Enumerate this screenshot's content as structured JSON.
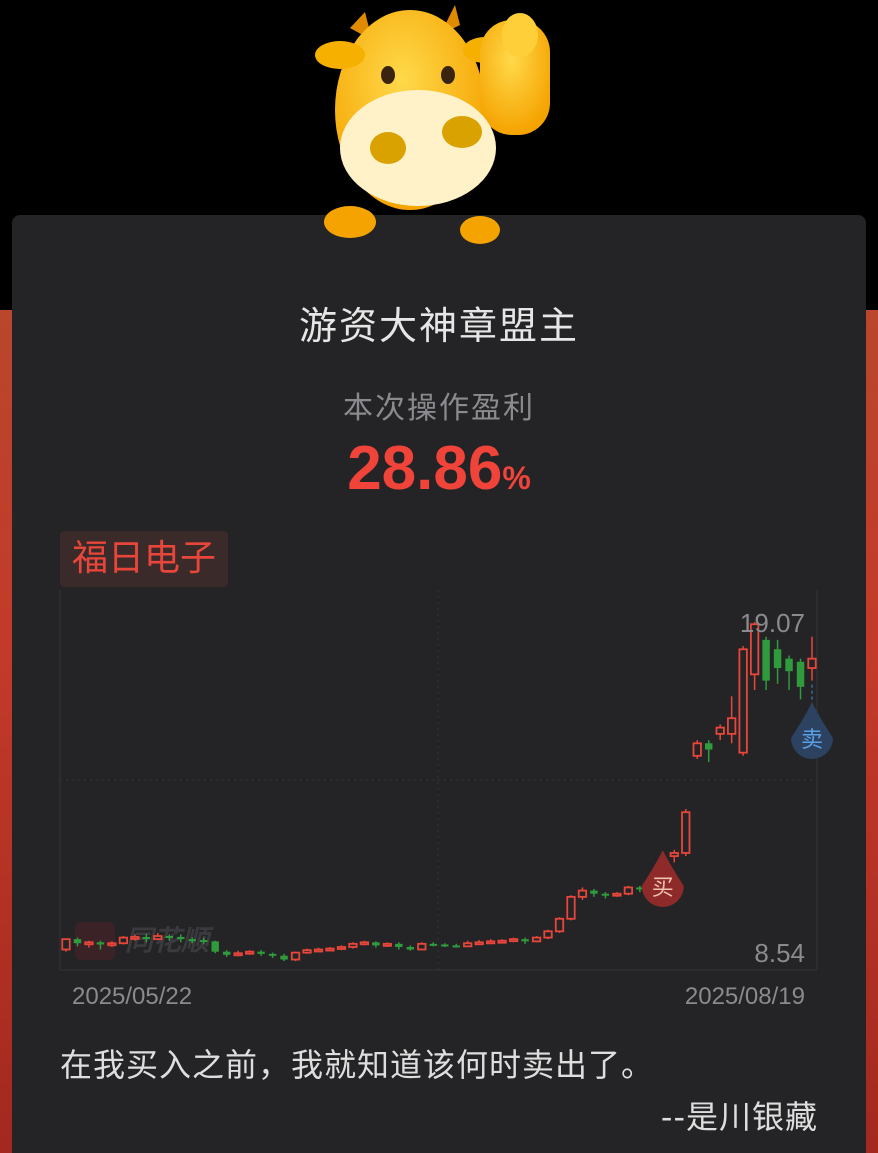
{
  "header": {
    "title": "游资大神章盟主",
    "subtitle": "本次操作盈利",
    "profit_value": "28.86",
    "profit_unit": "%"
  },
  "stock": {
    "name": "福日电子"
  },
  "watermark": {
    "text": "同花顺"
  },
  "markers": {
    "buy": "买",
    "sell": "卖"
  },
  "colors": {
    "background": "#000000",
    "card": "#242426",
    "profit_red": "#f0433a",
    "up_candle": "#e8463b",
    "down_candle": "#2f9b3c",
    "sell_marker": "#34495e"
  },
  "chart_data": {
    "type": "candlestick",
    "max_label": "19.07",
    "min_label": "8.54",
    "x_start_label": "2025/05/22",
    "x_end_label": "2025/08/19",
    "ylim": [
      8.54,
      19.07
    ],
    "candles": [
      [
        8.62,
        8.95,
        8.55,
        8.95
      ],
      [
        8.95,
        8.82,
        8.72,
        9.0
      ],
      [
        8.82,
        8.85,
        8.68,
        8.9
      ],
      [
        8.85,
        8.78,
        8.62,
        8.9
      ],
      [
        8.78,
        8.82,
        8.7,
        8.88
      ],
      [
        8.82,
        9.0,
        8.78,
        9.05
      ],
      [
        8.98,
        9.02,
        8.9,
        9.1
      ],
      [
        9.02,
        8.95,
        8.85,
        9.12
      ],
      [
        8.95,
        9.05,
        8.92,
        9.15
      ],
      [
        9.05,
        9.02,
        8.9,
        9.1
      ],
      [
        9.02,
        8.95,
        8.85,
        9.1
      ],
      [
        8.95,
        8.92,
        8.82,
        9.0
      ],
      [
        8.92,
        8.88,
        8.78,
        9.0
      ],
      [
        8.88,
        8.55,
        8.5,
        8.9
      ],
      [
        8.55,
        8.45,
        8.38,
        8.6
      ],
      [
        8.45,
        8.5,
        8.4,
        8.58
      ],
      [
        8.5,
        8.55,
        8.45,
        8.6
      ],
      [
        8.55,
        8.48,
        8.42,
        8.6
      ],
      [
        8.48,
        8.42,
        8.35,
        8.52
      ],
      [
        8.42,
        8.3,
        8.25,
        8.48
      ],
      [
        8.3,
        8.52,
        8.25,
        8.55
      ],
      [
        8.52,
        8.6,
        8.48,
        8.65
      ],
      [
        8.6,
        8.62,
        8.55,
        8.68
      ],
      [
        8.62,
        8.65,
        8.58,
        8.7
      ],
      [
        8.65,
        8.7,
        8.6,
        8.75
      ],
      [
        8.7,
        8.8,
        8.65,
        8.85
      ],
      [
        8.8,
        8.85,
        8.75,
        8.9
      ],
      [
        8.85,
        8.75,
        8.68,
        8.88
      ],
      [
        8.75,
        8.8,
        8.7,
        8.85
      ],
      [
        8.8,
        8.7,
        8.62,
        8.85
      ],
      [
        8.7,
        8.62,
        8.58,
        8.75
      ],
      [
        8.62,
        8.8,
        8.6,
        8.85
      ],
      [
        8.8,
        8.78,
        8.72,
        8.85
      ],
      [
        8.78,
        8.75,
        8.7,
        8.82
      ],
      [
        8.75,
        8.72,
        8.68,
        8.8
      ],
      [
        8.72,
        8.82,
        8.7,
        8.9
      ],
      [
        8.82,
        8.85,
        8.78,
        8.92
      ],
      [
        8.85,
        8.88,
        8.8,
        8.95
      ],
      [
        8.88,
        8.9,
        8.82,
        8.95
      ],
      [
        8.9,
        8.95,
        8.85,
        9.0
      ],
      [
        8.95,
        8.88,
        8.8,
        9.0
      ],
      [
        8.88,
        9.0,
        8.85,
        9.05
      ],
      [
        9.0,
        9.2,
        8.95,
        9.25
      ],
      [
        9.2,
        9.6,
        9.15,
        9.65
      ],
      [
        9.6,
        10.3,
        9.55,
        10.35
      ],
      [
        10.3,
        10.5,
        10.2,
        10.6
      ],
      [
        10.5,
        10.4,
        10.3,
        10.55
      ],
      [
        10.4,
        10.35,
        10.25,
        10.45
      ],
      [
        10.35,
        10.4,
        10.3,
        10.45
      ],
      [
        10.4,
        10.6,
        10.35,
        10.65
      ],
      [
        10.6,
        10.55,
        10.45,
        10.65
      ],
      [
        10.55,
        10.6,
        10.5,
        10.65
      ],
      [
        10.25,
        11.1,
        10.2,
        11.2
      ],
      [
        11.6,
        11.7,
        11.4,
        11.8
      ],
      [
        11.7,
        13.0,
        11.6,
        13.1
      ],
      [
        14.8,
        15.2,
        14.7,
        15.3
      ],
      [
        15.2,
        15.0,
        14.6,
        15.3
      ],
      [
        15.5,
        15.7,
        15.3,
        15.8
      ],
      [
        15.5,
        16.0,
        15.2,
        16.7
      ],
      [
        14.9,
        18.2,
        14.8,
        18.3
      ],
      [
        17.4,
        19.0,
        16.9,
        19.07
      ],
      [
        18.5,
        17.2,
        16.9,
        18.6
      ],
      [
        18.2,
        17.6,
        17.1,
        18.5
      ],
      [
        17.9,
        17.5,
        16.9,
        18.0
      ],
      [
        17.8,
        17.0,
        16.6,
        17.9
      ],
      [
        17.6,
        17.9,
        17.2,
        18.6
      ]
    ],
    "buy_index": 52,
    "sell_index": 65
  },
  "footer": {
    "quote": "在我买入之前，我就知道该何时卖出了。",
    "author": "--是川银藏"
  }
}
